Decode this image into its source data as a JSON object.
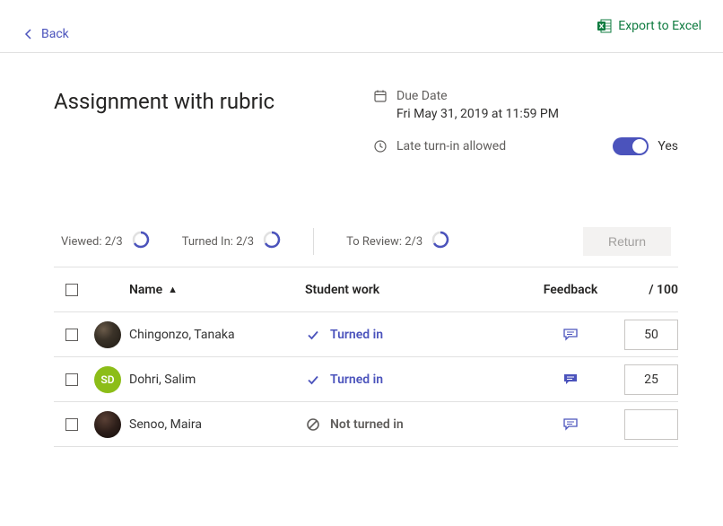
{
  "top": {
    "back": "Back",
    "export": "Export to Excel"
  },
  "assignment": {
    "title": "Assignment with rubric",
    "due_label": "Due Date",
    "due_value": "Fri May 31, 2019 at 11:59 PM",
    "late_label": "Late turn-in allowed",
    "late_value": "Yes"
  },
  "stats": {
    "viewed_label": "Viewed: 2/3",
    "turned_in_label": "Turned In: 2/3",
    "to_review_label": "To Review: 2/3",
    "return_label": "Return"
  },
  "table": {
    "header": {
      "name": "Name",
      "work": "Student work",
      "feedback": "Feedback",
      "score": "/ 100"
    },
    "rows": [
      {
        "name": "Chingonzo, Tanaka",
        "status": "Turned in",
        "status_type": "turned_in",
        "score": "50",
        "fb_filled": false,
        "avatar_type": "photo1",
        "initials": ""
      },
      {
        "name": "Dohri, Salim",
        "status": "Turned in",
        "status_type": "turned_in",
        "score": "25",
        "fb_filled": true,
        "avatar_type": "initials",
        "initials": "SD"
      },
      {
        "name": "Senoo, Maira",
        "status": "Not turned in",
        "status_type": "not_turned_in",
        "score": "",
        "fb_filled": false,
        "avatar_type": "photo3",
        "initials": ""
      }
    ]
  }
}
